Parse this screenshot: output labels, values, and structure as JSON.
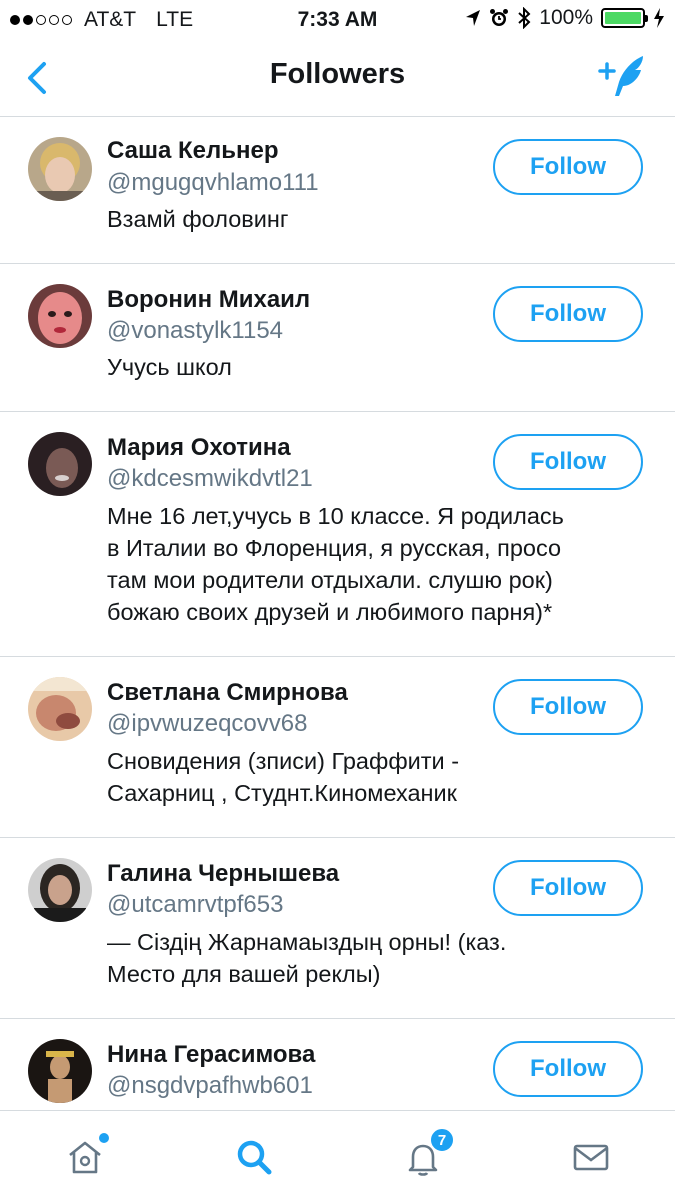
{
  "status_bar": {
    "carrier": "AT&T",
    "network": "LTE",
    "time": "7:33 AM",
    "battery": "100%",
    "signal_bars_filled": 2,
    "signal_bars_total": 5
  },
  "nav": {
    "title": "Followers",
    "back_icon": "chevron-left-icon",
    "compose_icon": "add-user-feather-icon"
  },
  "followers": [
    {
      "name": "Саша Кельнер",
      "handle": "@mgugqvhlamo111",
      "bio": "Взамй фоловинг",
      "follow_label": "Follow"
    },
    {
      "name": "Воронин Михаил",
      "handle": "@vonastylk1154",
      "bio": "Учусь школ",
      "follow_label": "Follow"
    },
    {
      "name": "Мария Охотина",
      "handle": "@kdcesmwikdvtl21",
      "bio": "Мне 16 лет,учусь в 10 классе. Я родилась\nв Италии во Флоренция, я русская, просо\nтам мои родители отдыхали. слушю рок)\nбожаю своих друзей и любимого парня)*",
      "follow_label": "Follow"
    },
    {
      "name": "Светлана Смирнова",
      "handle": "@ipvwuzeqcovv68",
      "bio": "Сновидения (зписи) Граффити -\nСахарниц , Студнт.Киномеханик",
      "follow_label": "Follow"
    },
    {
      "name": "Галина Чернышева",
      "handle": "@utcamrvtpf653",
      "bio": "— Сіздің Жарнамаыздың орны! (каз.\nМесто для вашей реклы)",
      "follow_label": "Follow"
    },
    {
      "name": "Нина Герасимова",
      "handle": "@nsgdvpafhwb601",
      "bio": "",
      "follow_label": "Follow"
    }
  ],
  "tab_bar": {
    "home_icon": "home-icon",
    "search_icon": "search-icon",
    "notifications_icon": "bell-icon",
    "notifications_badge": "7",
    "messages_icon": "envelope-icon"
  },
  "colors": {
    "accent": "#1da1f2",
    "secondary_text": "#657786",
    "divider": "#d6dbdf",
    "battery_fill": "#4cd964"
  }
}
